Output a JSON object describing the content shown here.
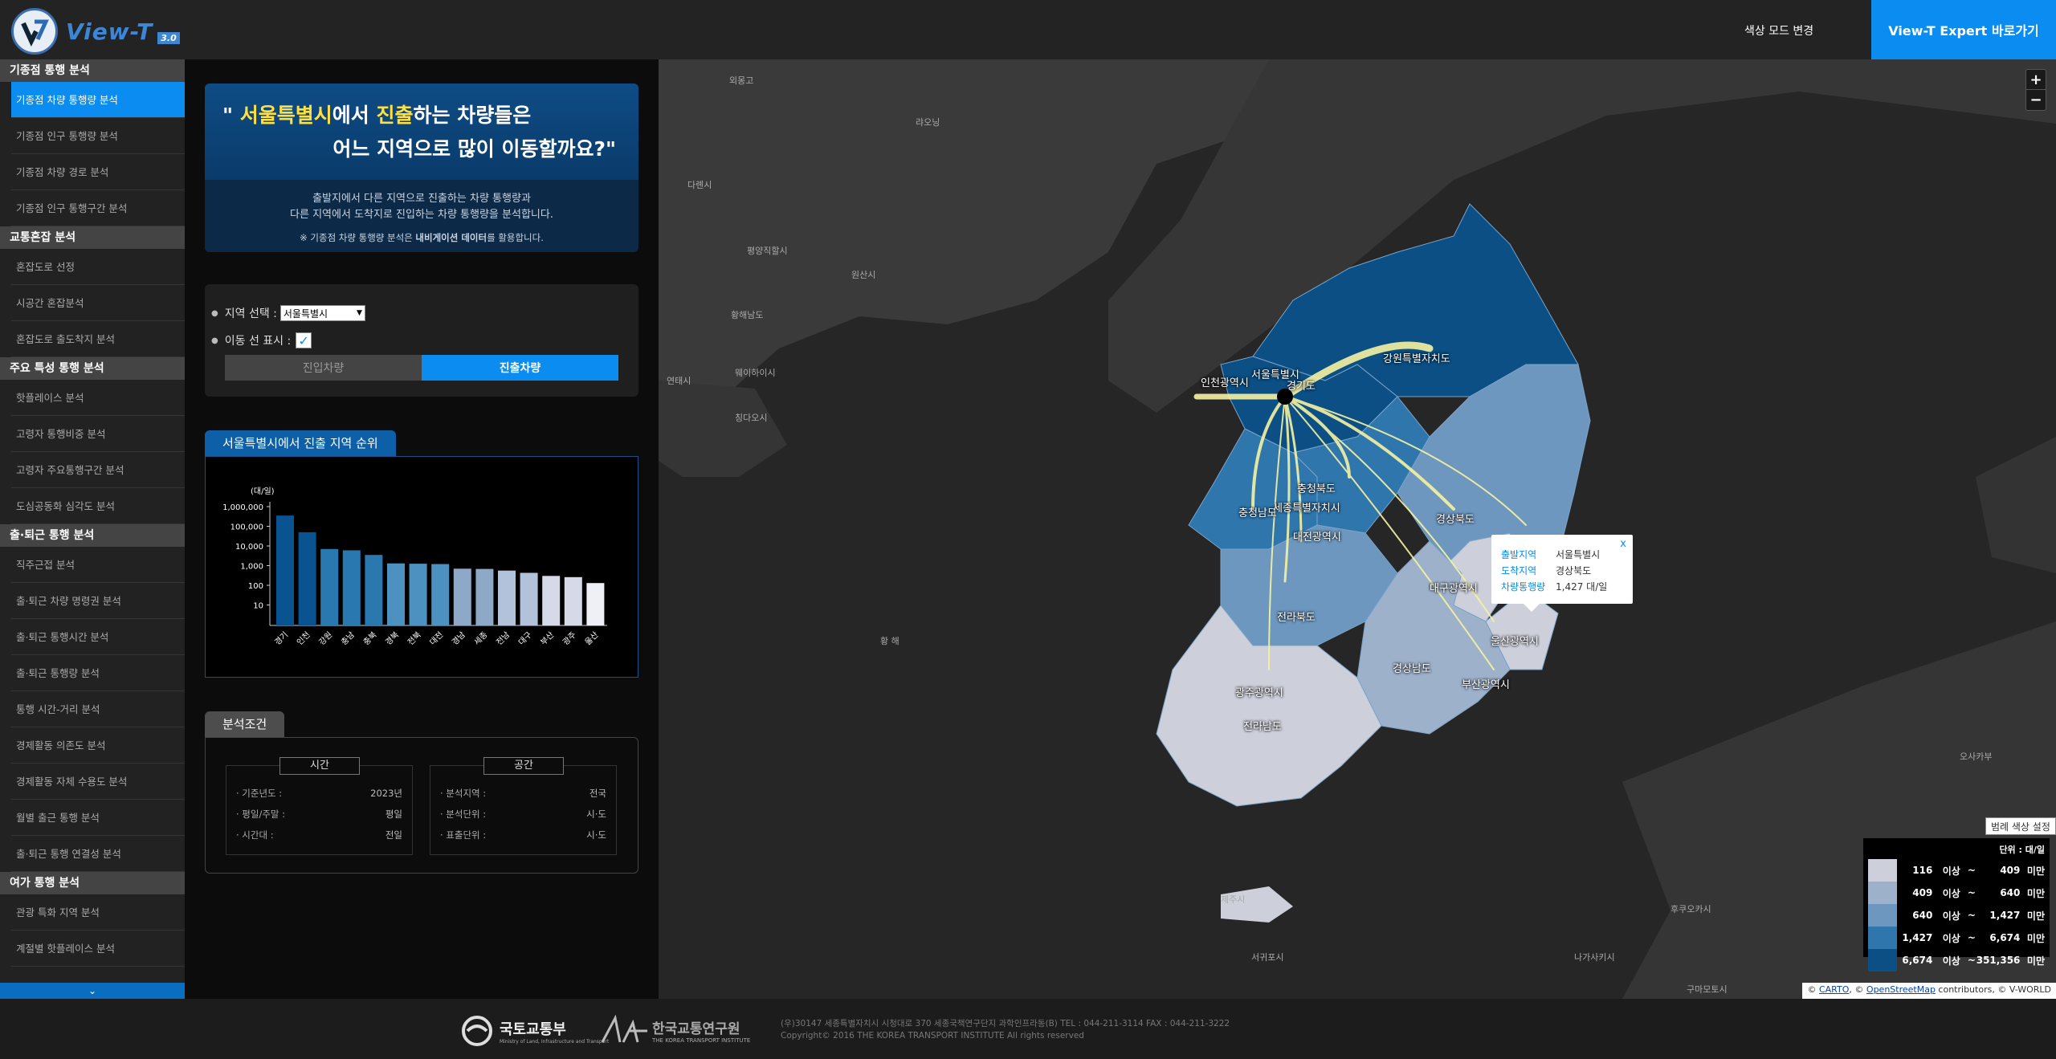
{
  "header": {
    "logo_text": "View-T",
    "logo_version": "3.0",
    "color_mode_label": "색상 모드 변경",
    "expert_button": "View-T Expert 바로가기"
  },
  "sidebar": {
    "sections": [
      {
        "title": "기종점 통행 분석",
        "items": [
          "기종점 차량 통행량 분석",
          "기종점 인구 통행량 분석",
          "기종점 차량 경로 분석",
          "기종점 인구 통행구간 분석"
        ]
      },
      {
        "title": "교통혼잡 분석",
        "items": [
          "혼잡도로 선정",
          "시공간 혼잡분석",
          "혼잡도로 출도착지 분석"
        ]
      },
      {
        "title": "주요 특성 통행 분석",
        "items": [
          "핫플레이스 분석",
          "고령자 통행비중 분석",
          "고령자 주요통행구간 분석",
          "도심공동화 심각도 분석"
        ]
      },
      {
        "title": "출·퇴근 통행 분석",
        "items": [
          "직주근접 분석",
          "출·퇴근 차량 명령권 분석",
          "출·퇴근 통행시간 분석",
          "출·퇴근 통행량 분석",
          "통행 시간-거리 분석",
          "경제활동 의존도 분석",
          "경제활동 자체 수용도 분석",
          "월별 출근 통행 분석",
          "출·퇴근 통행 연결성 분석"
        ]
      },
      {
        "title": "여가 통행 분석",
        "items": [
          "관광 특화 지역 분석",
          "계절별 핫플레이스 분석"
        ]
      }
    ],
    "active_item": "기종점 차량 통행량 분석"
  },
  "intro": {
    "q_open": "\" ",
    "q_region": "서울특별시",
    "q_mid": "에서 ",
    "q_dir": "진출",
    "q_end": "하는 차량들은",
    "q_line2": "어느 지역으로 많이 이동할까요?\"",
    "desc1": "출발지에서 다른 지역으로 진출하는 차량 통행량과",
    "desc2": "다른 지역에서 도착지로 진입하는 차량 통행량을 분석합니다.",
    "note_prefix": "※ 기종점 차량 통행량 분석은 ",
    "note_bold": "내비게이션 데이터",
    "note_suffix": "를 활용합니다."
  },
  "controls": {
    "region_label": "지역 선택 :",
    "region_value": "서울특별시",
    "line_label": "이동 선 표시 :",
    "toggle_in": "진입차량",
    "toggle_out": "진출차량"
  },
  "ranking": {
    "tab_label": "서울특별시에서 진출 지역 순위"
  },
  "chart_data": {
    "type": "bar",
    "title": "",
    "ylabel": "(대/일)",
    "yscale": "log",
    "ylim": [
      1,
      1000000
    ],
    "yticks": [
      "1,000,000",
      "100,000",
      "10,000",
      "1,000",
      "100",
      "10"
    ],
    "categories": [
      "경기",
      "인천",
      "강원",
      "충남",
      "충북",
      "경북",
      "전북",
      "대전",
      "경남",
      "세종",
      "전남",
      "대구",
      "부산",
      "광주",
      "울산"
    ],
    "values": [
      351356,
      50000,
      7000,
      6000,
      3500,
      1300,
      1250,
      1200,
      700,
      680,
      560,
      430,
      300,
      260,
      130
    ],
    "colors": [
      "#0a5391",
      "#0a5391",
      "#2a78b0",
      "#2a78b0",
      "#2a78b0",
      "#4d91c1",
      "#4d91c1",
      "#4d91c1",
      "#8ea8c8",
      "#8ea8c8",
      "#b3c2db",
      "#b3c2db",
      "#d5d9e8",
      "#d5d9e8",
      "#eef0f5"
    ]
  },
  "conditions": {
    "tab_label": "분석조건",
    "time": {
      "title": "시간",
      "rows": [
        [
          "· 기준년도 :",
          "2023년"
        ],
        [
          "· 평일/주말 :",
          "평일"
        ],
        [
          "· 시간대 :",
          "전일"
        ]
      ]
    },
    "space": {
      "title": "공간",
      "rows": [
        [
          "· 분석지역 :",
          "전국"
        ],
        [
          "· 분석단위 :",
          "시·도"
        ],
        [
          "· 표출단위 :",
          "시·도"
        ]
      ]
    }
  },
  "map": {
    "zoom_in": "+",
    "zoom_out": "−",
    "labels": [
      "강원특별자치도",
      "인천광역시",
      "서울특별시",
      "경기도",
      "충청북도",
      "충청남도",
      "세종특별자치시",
      "대전광역시",
      "경상북도",
      "대구광역시",
      "전라북도",
      "울산광역시",
      "경상남도",
      "부산광역시",
      "광주광역시",
      "전라남도"
    ],
    "country_labels": [
      "외몽고",
      "랴오닝",
      "다롄시",
      "평양직할시",
      "황해남도",
      "원산시",
      "연태시",
      "웨이하이시",
      "칭다오시",
      "황 해",
      "제주시",
      "서귀포시",
      "후쿠오카시",
      "나가사키시",
      "구마모토시",
      "오사카부"
    ],
    "tooltip": {
      "close": "x",
      "rows": [
        [
          "출발지역",
          "서울특별시"
        ],
        [
          "도착지역",
          "경상북도"
        ],
        [
          "차량통행량",
          "1,427 대/일"
        ]
      ]
    },
    "legend_settings": "범례 색상 설정",
    "legend_unit": "단위 : 대/일",
    "legend": [
      {
        "from": "116",
        "to": "409",
        "color": "#cdcfdb"
      },
      {
        "from": "409",
        "to": "640",
        "color": "#9eb1cb"
      },
      {
        "from": "640",
        "to": "1,427",
        "color": "#6d97bf"
      },
      {
        "from": "1,427",
        "to": "6,674",
        "color": "#2f76ad"
      },
      {
        "from": "6,674",
        "to": "351,356",
        "color": "#0b4f85"
      }
    ],
    "legend_words": {
      "above": "이상",
      "tilde": "~",
      "below": "미만"
    },
    "attribution_prefix": "© ",
    "attribution_carto": "CARTO",
    "attribution_mid": ", © ",
    "attribution_osm": "OpenStreetMap",
    "attribution_suffix": " contributors, © V-WORLD"
  },
  "footer": {
    "molit_name": "국토교통부",
    "molit_sub": "Ministry of Land, Infrastructure and Transport",
    "koti_name": "한국교통연구원",
    "koti_sub": "THE KOREA TRANSPORT INSTITUTE",
    "address": "(우)30147 세종특별자치시 시청대로 370 세종국책연구단지 과학인프라동(B) TEL : 044-211-3114 FAX : 044-211-3222",
    "copyright": "Copyright© 2016 THE KOREA TRANSPORT INSTITUTE All rights reserved"
  }
}
